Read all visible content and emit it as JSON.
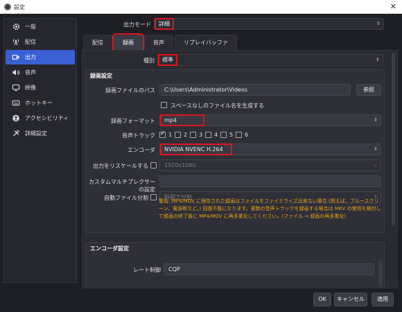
{
  "window": {
    "title": "設定"
  },
  "sidebar": {
    "items": [
      {
        "label": "一般",
        "icon": "gear-icon"
      },
      {
        "label": "配信",
        "icon": "broadcast-icon"
      },
      {
        "label": "出力",
        "icon": "output-icon",
        "active": true
      },
      {
        "label": "音声",
        "icon": "speaker-icon"
      },
      {
        "label": "映像",
        "icon": "monitor-icon"
      },
      {
        "label": "ホットキー",
        "icon": "keyboard-icon"
      },
      {
        "label": "アクセシビリティ",
        "icon": "accessibility-icon"
      },
      {
        "label": "詳細設定",
        "icon": "tools-icon"
      }
    ]
  },
  "output_mode": {
    "label": "出力モード",
    "value": "詳細"
  },
  "tabs": [
    {
      "label": "配信"
    },
    {
      "label": "録画",
      "active": true
    },
    {
      "label": "音声"
    },
    {
      "label": "リプレイバッファ"
    }
  ],
  "type": {
    "label": "種別",
    "value": "標準"
  },
  "recording": {
    "group_title": "録画設定",
    "path_label": "録画ファイルのパス",
    "path_value": "C:\\Users\\Administrator\\Videos",
    "browse_label": "参照",
    "no_space_label": "スペースなしのファイル名を生成する",
    "format_label": "録画フォーマット",
    "format_value": "mp4",
    "audio_track_label": "音声トラック",
    "tracks": [
      "1",
      "2",
      "3",
      "4",
      "5",
      "6"
    ],
    "encoder_label": "エンコーダ",
    "encoder_value": "NVIDIA NVENC H.264",
    "rescale_label": "出力をリスケールする",
    "rescale_value": "1920x1080",
    "muxer_label": "カスタムマルチプレクサーの設定",
    "muxer_value": "",
    "autosplit_label": "自動ファイル分割",
    "autosplit_value": "時間で分割",
    "warning": "警告: MP4/MOV に保存された録画はファイルをファイナライズ出来ない場合 (例えば、ブルースクリーン、電源断など。) 回復不能になります。複数の音声トラックを録画する場合は MKV の使用を検討して録画の終了後に MP4/MOV に再多重化してください。(ファイル → 録画の再多重化)"
  },
  "encoder_settings": {
    "group_title": "エンコーダ設定",
    "rate_control_label": "レート制御",
    "rate_control_value": "CQP"
  },
  "footer": {
    "ok": "OK",
    "cancel": "キャンセル",
    "apply": "適用"
  },
  "colors": {
    "accent": "#3a5fd1",
    "highlight": "#e0141e",
    "warning": "#e8a317"
  }
}
